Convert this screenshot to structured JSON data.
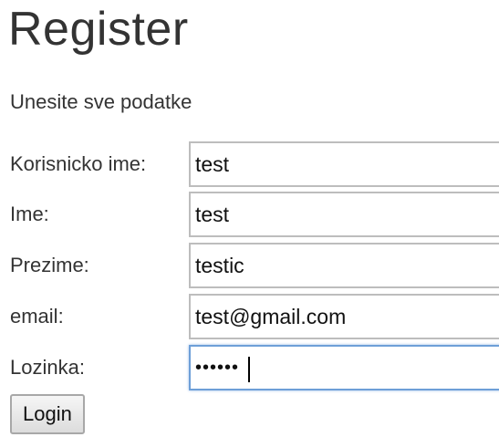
{
  "page": {
    "title": "Register",
    "subtitle": "Unesite sve podatke"
  },
  "form": {
    "fields": [
      {
        "label": "Korisnicko ime:",
        "value": "test",
        "type": "text"
      },
      {
        "label": "Ime:",
        "value": "test",
        "type": "text"
      },
      {
        "label": "Prezime:",
        "value": "testic",
        "type": "text"
      },
      {
        "label": "email:",
        "value": "test@gmail.com",
        "type": "text"
      },
      {
        "label": "Lozinka:",
        "value": "••••••",
        "type": "password"
      }
    ],
    "submit_label": "Login"
  }
}
